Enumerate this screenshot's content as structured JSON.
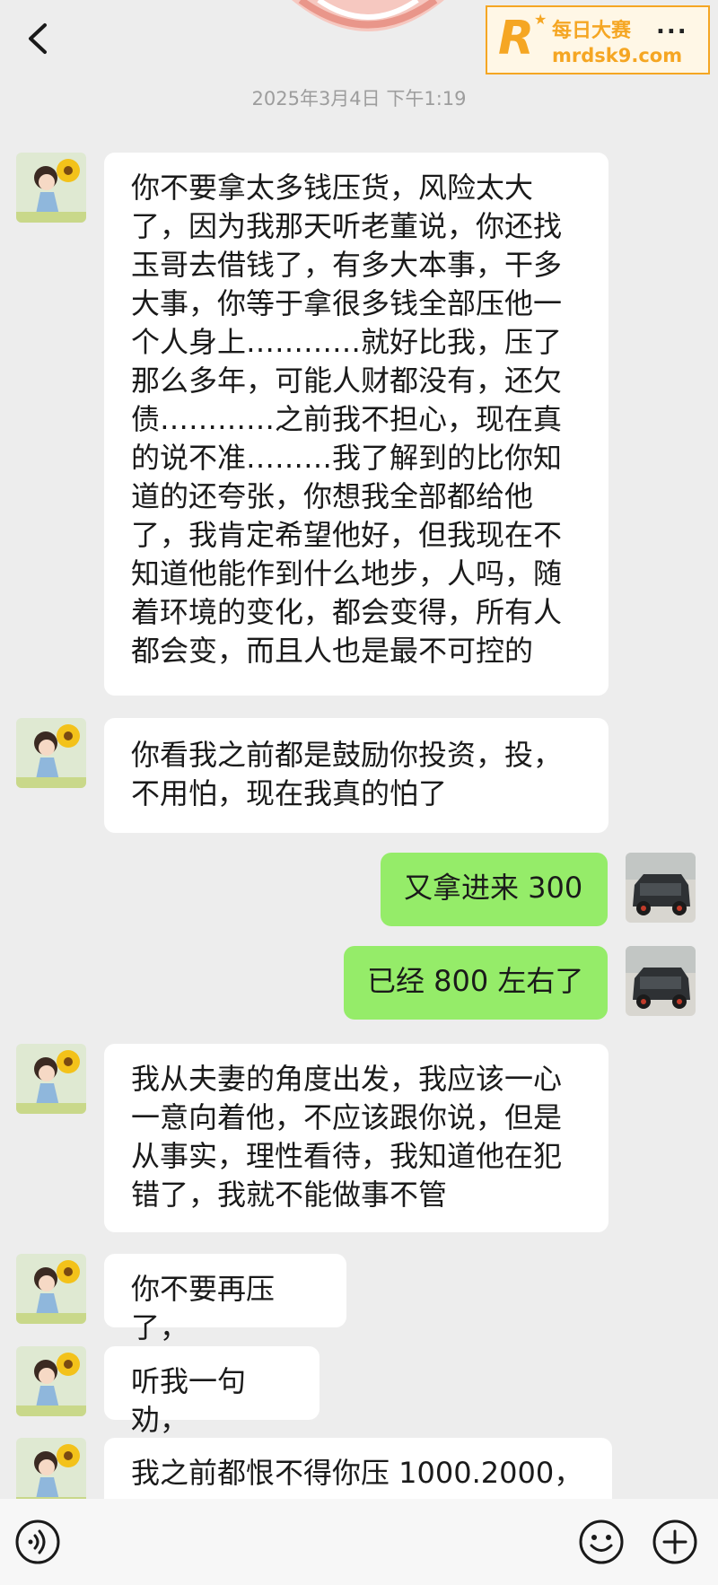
{
  "header": {
    "back_icon": "chevron-left-icon",
    "timestamp": "2025年3月4日 下午1:19"
  },
  "watermark": {
    "logo_letter": "R",
    "line1": "每日大赛",
    "line2": "mrdsk9.com",
    "more": "..."
  },
  "messages": [
    {
      "sender": "other",
      "text": "你不要拿太多钱压货，风险太大了，因为我那天听老董说，你还找玉哥去借钱了，有多大本事，干多大事，你等于拿很多钱全部压他一个人身上…………就好比我，压了那么多年，可能人财都没有，还欠债…………之前我不担心，现在真的说不准………我了解到的比你知道的还夸张，你想我全部都给他了，我肯定希望他好，但我现在不知道他能作到什么地步，人吗，随着环境的变化，都会变得，所有人都会变，而且人也是最不可控的"
    },
    {
      "sender": "other",
      "text": "你看我之前都是鼓励你投资，投，不用怕，现在我真的怕了"
    },
    {
      "sender": "me",
      "text": "又拿进来 300"
    },
    {
      "sender": "me",
      "text": "已经 800 左右了"
    },
    {
      "sender": "other",
      "text": "我从夫妻的角度出发，我应该一心一意向着他，不应该跟你说，但是从事实，理性看待，我知道他在犯错了，我就不能做事不管"
    },
    {
      "sender": "other",
      "text": "你不要再压了，"
    },
    {
      "sender": "other",
      "text": "听我一句劝，"
    },
    {
      "sender": "other",
      "text": "我之前都恨不得你压 1000.2000，"
    }
  ],
  "bottom_bar": {
    "voice_icon": "voice-icon",
    "emoji_icon": "emoji-icon",
    "plus_icon": "plus-icon"
  }
}
